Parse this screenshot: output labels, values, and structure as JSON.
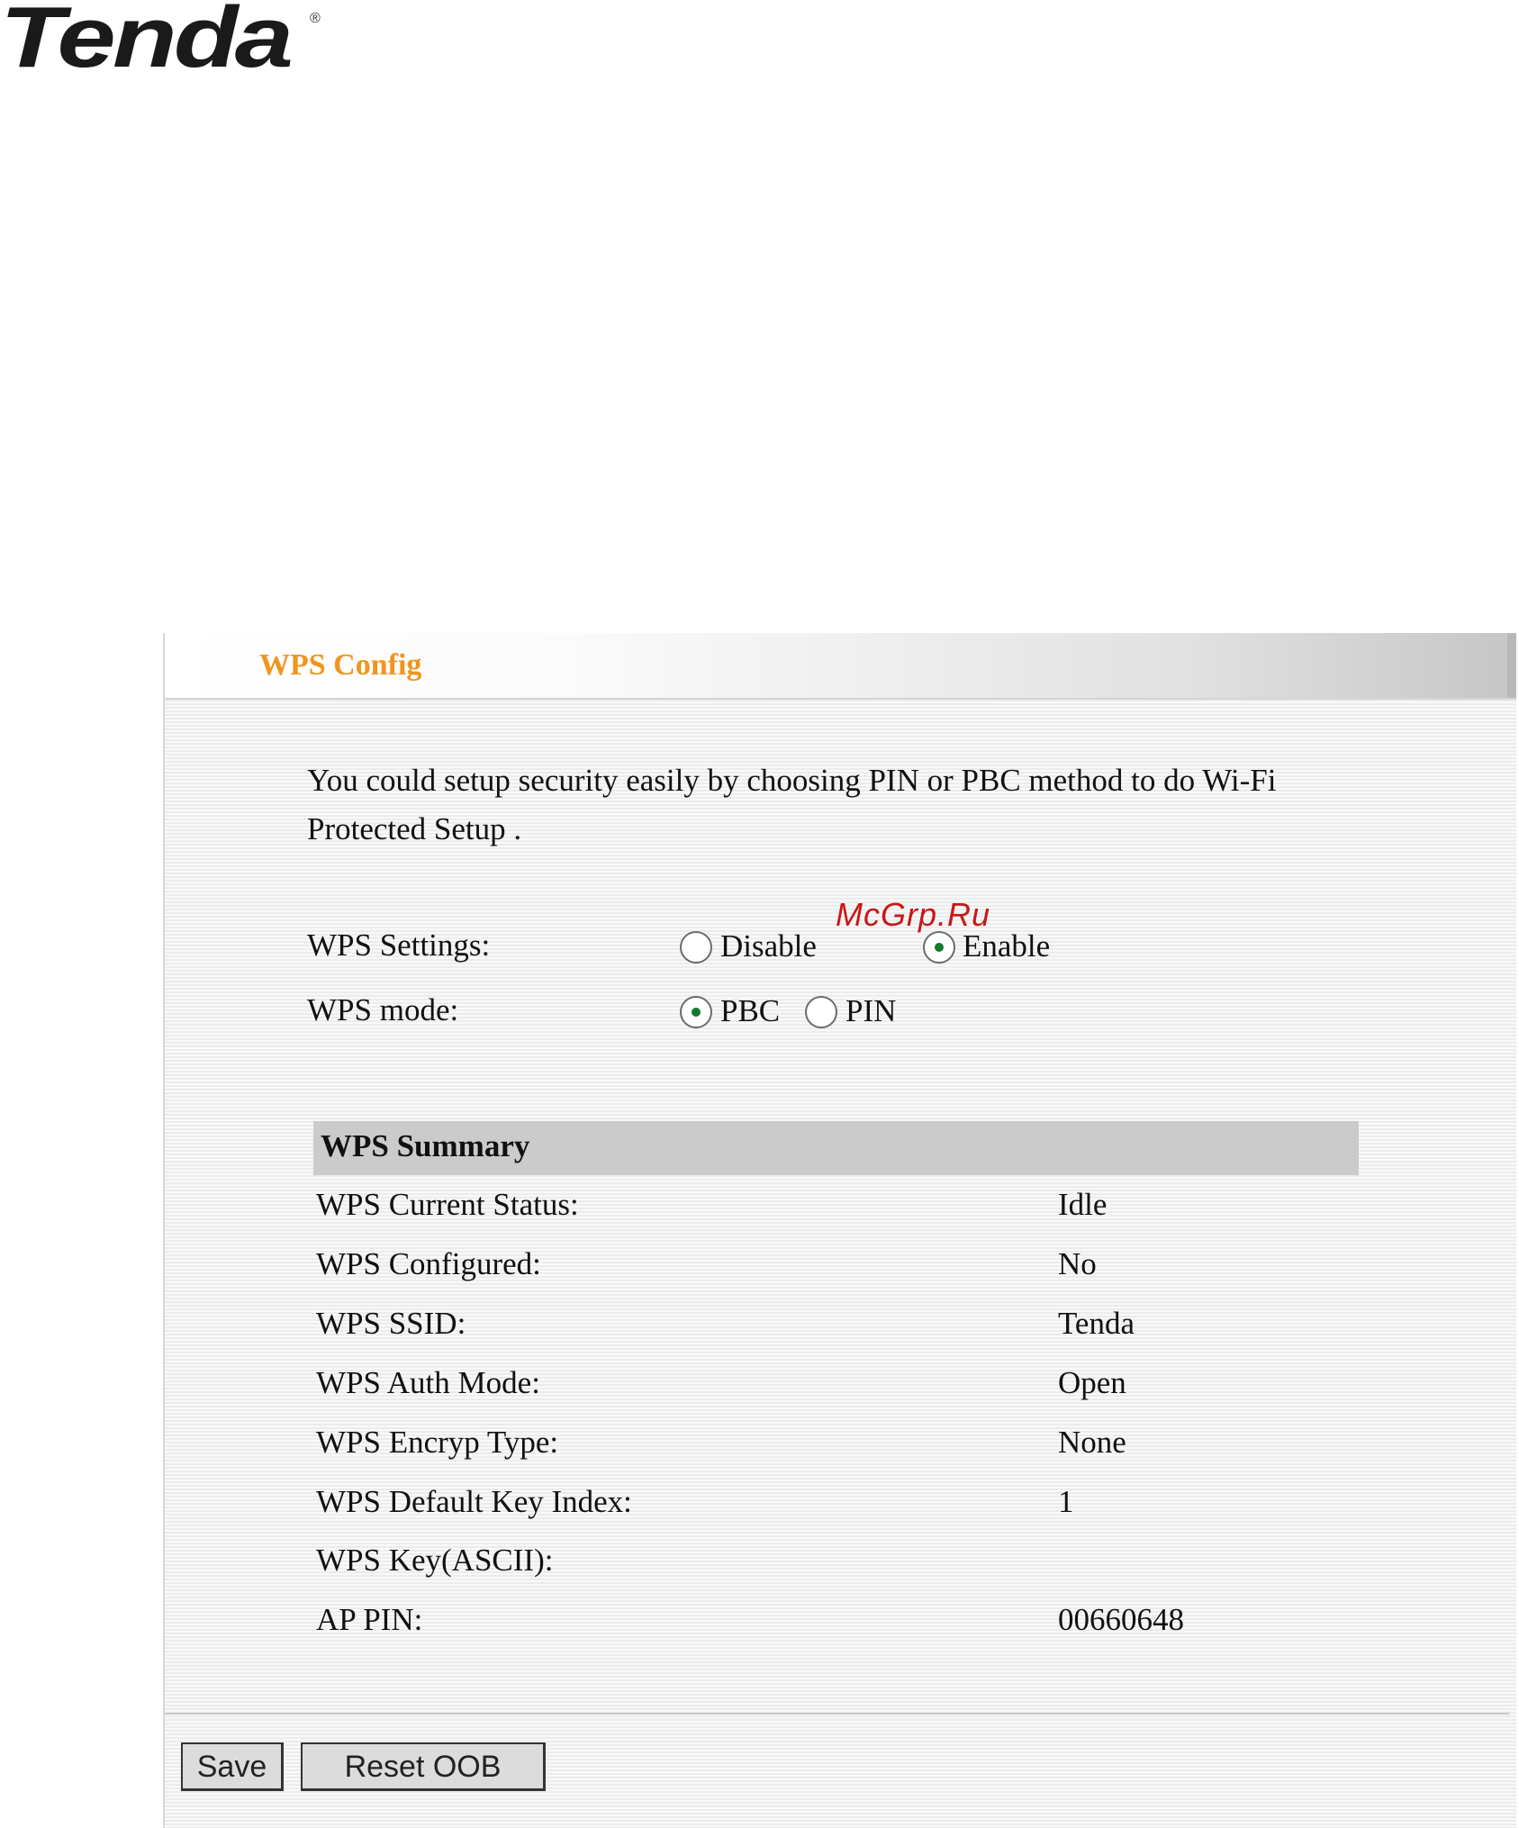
{
  "logo": {
    "text": "Tenda",
    "registered_mark": "®"
  },
  "watermark": "McGrp.Ru",
  "panel": {
    "title": "WPS Config",
    "intro_line1": "You could setup security easily by choosing PIN or PBC method to do Wi-Fi",
    "intro_line2": "Protected Setup ."
  },
  "wps_settings": {
    "label": "WPS Settings:",
    "options": [
      {
        "label": "Disable",
        "checked": false
      },
      {
        "label": "Enable",
        "checked": true
      }
    ]
  },
  "wps_mode": {
    "label": "WPS mode:",
    "options": [
      {
        "label": "PBC",
        "checked": true
      },
      {
        "label": "PIN",
        "checked": false
      }
    ]
  },
  "summary": {
    "title": "WPS Summary",
    "rows": [
      {
        "label": "WPS Current Status:",
        "value": "Idle"
      },
      {
        "label": "WPS Configured:",
        "value": "No"
      },
      {
        "label": "WPS SSID:",
        "value": "Tenda"
      },
      {
        "label": "WPS Auth Mode:",
        "value": "Open"
      },
      {
        "label": "WPS Encryp Type:",
        "value": "None"
      },
      {
        "label": "WPS Default Key Index:",
        "value": "1"
      },
      {
        "label": "WPS Key(ASCII):",
        "value": ""
      },
      {
        "label": "AP PIN:",
        "value": "00660648"
      }
    ]
  },
  "buttons": {
    "save": "Save",
    "reset": "Reset OOB"
  },
  "colors": {
    "title_orange": "#f0951f",
    "radio_dot": "#117a2d",
    "watermark_red": "#c81818"
  }
}
